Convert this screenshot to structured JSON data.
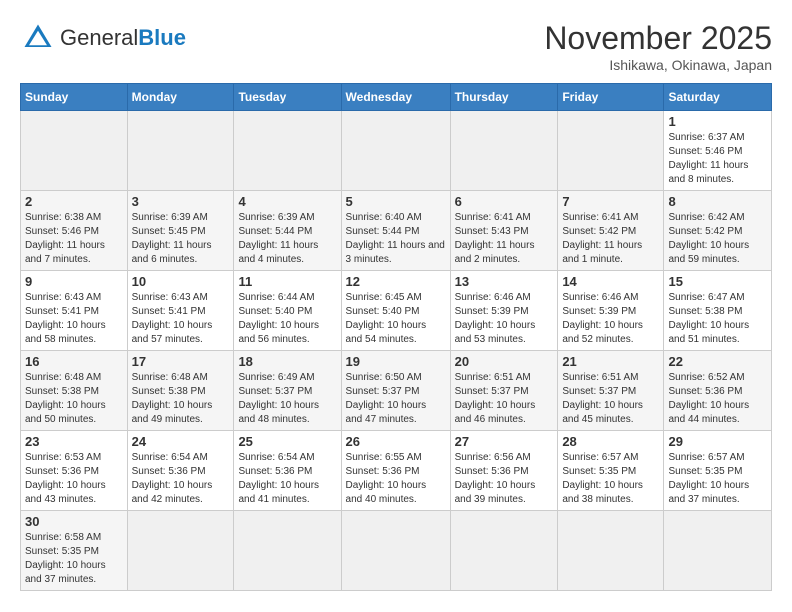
{
  "header": {
    "logo_general": "General",
    "logo_blue": "Blue",
    "month_title": "November 2025",
    "location": "Ishikawa, Okinawa, Japan"
  },
  "weekdays": [
    "Sunday",
    "Monday",
    "Tuesday",
    "Wednesday",
    "Thursday",
    "Friday",
    "Saturday"
  ],
  "weeks": [
    [
      {
        "day": "",
        "info": ""
      },
      {
        "day": "",
        "info": ""
      },
      {
        "day": "",
        "info": ""
      },
      {
        "day": "",
        "info": ""
      },
      {
        "day": "",
        "info": ""
      },
      {
        "day": "",
        "info": ""
      },
      {
        "day": "1",
        "info": "Sunrise: 6:37 AM\nSunset: 5:46 PM\nDaylight: 11 hours and 8 minutes."
      }
    ],
    [
      {
        "day": "2",
        "info": "Sunrise: 6:38 AM\nSunset: 5:46 PM\nDaylight: 11 hours and 7 minutes."
      },
      {
        "day": "3",
        "info": "Sunrise: 6:39 AM\nSunset: 5:45 PM\nDaylight: 11 hours and 6 minutes."
      },
      {
        "day": "4",
        "info": "Sunrise: 6:39 AM\nSunset: 5:44 PM\nDaylight: 11 hours and 4 minutes."
      },
      {
        "day": "5",
        "info": "Sunrise: 6:40 AM\nSunset: 5:44 PM\nDaylight: 11 hours and 3 minutes."
      },
      {
        "day": "6",
        "info": "Sunrise: 6:41 AM\nSunset: 5:43 PM\nDaylight: 11 hours and 2 minutes."
      },
      {
        "day": "7",
        "info": "Sunrise: 6:41 AM\nSunset: 5:42 PM\nDaylight: 11 hours and 1 minute."
      },
      {
        "day": "8",
        "info": "Sunrise: 6:42 AM\nSunset: 5:42 PM\nDaylight: 10 hours and 59 minutes."
      }
    ],
    [
      {
        "day": "9",
        "info": "Sunrise: 6:43 AM\nSunset: 5:41 PM\nDaylight: 10 hours and 58 minutes."
      },
      {
        "day": "10",
        "info": "Sunrise: 6:43 AM\nSunset: 5:41 PM\nDaylight: 10 hours and 57 minutes."
      },
      {
        "day": "11",
        "info": "Sunrise: 6:44 AM\nSunset: 5:40 PM\nDaylight: 10 hours and 56 minutes."
      },
      {
        "day": "12",
        "info": "Sunrise: 6:45 AM\nSunset: 5:40 PM\nDaylight: 10 hours and 54 minutes."
      },
      {
        "day": "13",
        "info": "Sunrise: 6:46 AM\nSunset: 5:39 PM\nDaylight: 10 hours and 53 minutes."
      },
      {
        "day": "14",
        "info": "Sunrise: 6:46 AM\nSunset: 5:39 PM\nDaylight: 10 hours and 52 minutes."
      },
      {
        "day": "15",
        "info": "Sunrise: 6:47 AM\nSunset: 5:38 PM\nDaylight: 10 hours and 51 minutes."
      }
    ],
    [
      {
        "day": "16",
        "info": "Sunrise: 6:48 AM\nSunset: 5:38 PM\nDaylight: 10 hours and 50 minutes."
      },
      {
        "day": "17",
        "info": "Sunrise: 6:48 AM\nSunset: 5:38 PM\nDaylight: 10 hours and 49 minutes."
      },
      {
        "day": "18",
        "info": "Sunrise: 6:49 AM\nSunset: 5:37 PM\nDaylight: 10 hours and 48 minutes."
      },
      {
        "day": "19",
        "info": "Sunrise: 6:50 AM\nSunset: 5:37 PM\nDaylight: 10 hours and 47 minutes."
      },
      {
        "day": "20",
        "info": "Sunrise: 6:51 AM\nSunset: 5:37 PM\nDaylight: 10 hours and 46 minutes."
      },
      {
        "day": "21",
        "info": "Sunrise: 6:51 AM\nSunset: 5:37 PM\nDaylight: 10 hours and 45 minutes."
      },
      {
        "day": "22",
        "info": "Sunrise: 6:52 AM\nSunset: 5:36 PM\nDaylight: 10 hours and 44 minutes."
      }
    ],
    [
      {
        "day": "23",
        "info": "Sunrise: 6:53 AM\nSunset: 5:36 PM\nDaylight: 10 hours and 43 minutes."
      },
      {
        "day": "24",
        "info": "Sunrise: 6:54 AM\nSunset: 5:36 PM\nDaylight: 10 hours and 42 minutes."
      },
      {
        "day": "25",
        "info": "Sunrise: 6:54 AM\nSunset: 5:36 PM\nDaylight: 10 hours and 41 minutes."
      },
      {
        "day": "26",
        "info": "Sunrise: 6:55 AM\nSunset: 5:36 PM\nDaylight: 10 hours and 40 minutes."
      },
      {
        "day": "27",
        "info": "Sunrise: 6:56 AM\nSunset: 5:36 PM\nDaylight: 10 hours and 39 minutes."
      },
      {
        "day": "28",
        "info": "Sunrise: 6:57 AM\nSunset: 5:35 PM\nDaylight: 10 hours and 38 minutes."
      },
      {
        "day": "29",
        "info": "Sunrise: 6:57 AM\nSunset: 5:35 PM\nDaylight: 10 hours and 37 minutes."
      }
    ],
    [
      {
        "day": "30",
        "info": "Sunrise: 6:58 AM\nSunset: 5:35 PM\nDaylight: 10 hours and 37 minutes."
      },
      {
        "day": "",
        "info": ""
      },
      {
        "day": "",
        "info": ""
      },
      {
        "day": "",
        "info": ""
      },
      {
        "day": "",
        "info": ""
      },
      {
        "day": "",
        "info": ""
      },
      {
        "day": "",
        "info": ""
      }
    ]
  ]
}
